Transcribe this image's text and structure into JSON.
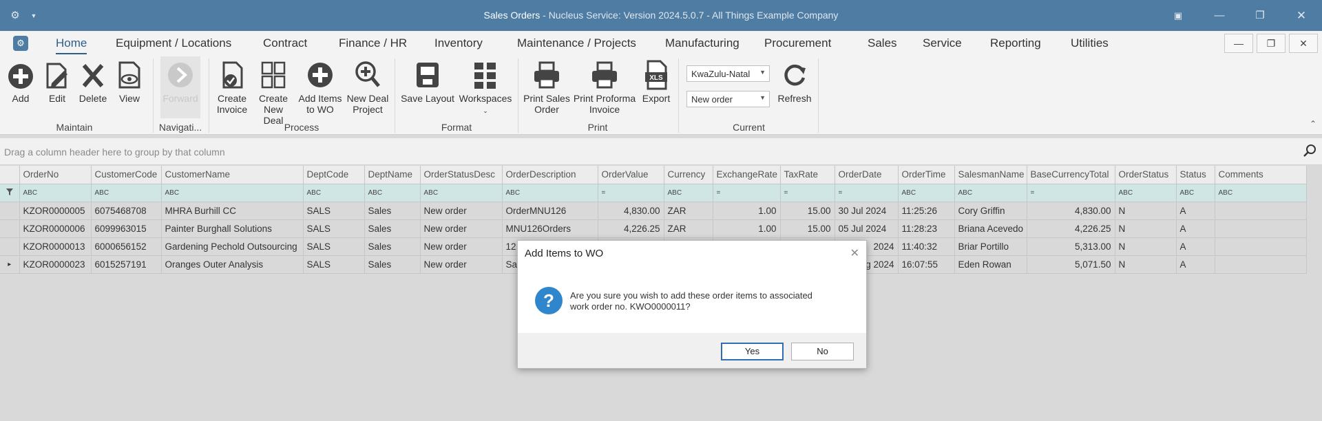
{
  "titlebar": {
    "app_title": "Sales Orders",
    "rest": " - Nucleus Service: Version 2024.5.0.7 - All Things Example Company"
  },
  "menu": {
    "items": [
      "Home",
      "Equipment / Locations",
      "Contract",
      "Finance / HR",
      "Inventory",
      "Maintenance / Projects",
      "Manufacturing",
      "Procurement",
      "Sales",
      "Service",
      "Reporting",
      "Utilities"
    ],
    "active": "Home"
  },
  "ribbon": {
    "maintain": {
      "label": "Maintain",
      "add": "Add",
      "edit": "Edit",
      "delete": "Delete",
      "view": "View"
    },
    "navigation": {
      "label": "Navigati...",
      "forward": "Forward"
    },
    "process": {
      "label": "Process",
      "create_invoice": [
        "Create",
        "Invoice"
      ],
      "create_new_deal": [
        "Create",
        "New Deal"
      ],
      "add_items_to_wo": [
        "Add Items",
        "to WO"
      ],
      "new_deal_project": [
        "New Deal",
        "Project"
      ]
    },
    "format": {
      "label": "Format",
      "save_layout": "Save Layout",
      "workspaces": "Workspaces"
    },
    "print": {
      "label": "Print",
      "print_sales_order": [
        "Print Sales",
        "Order"
      ],
      "print_proforma_invoice": [
        "Print Proforma",
        "Invoice"
      ],
      "export": "Export",
      "export_badge": "XLS"
    },
    "current": {
      "label": "Current",
      "region": "KwaZulu-Natal",
      "status": "New order",
      "refresh": "Refresh"
    }
  },
  "grouppanel": {
    "hint": "Drag a column header here to group by that column"
  },
  "grid": {
    "columns": [
      "OrderNo",
      "CustomerCode",
      "CustomerName",
      "DeptCode",
      "DeptName",
      "OrderStatusDesc",
      "OrderDescription",
      "OrderValue",
      "Currency",
      "ExchangeRate",
      "TaxRate",
      "OrderDate",
      "OrderTime",
      "SalesmanName",
      "BaseCurrencyTotal",
      "OrderStatus",
      "Status",
      "Comments"
    ],
    "filter_icons": [
      "ABC",
      "ABC",
      "ABC",
      "ABC",
      "ABC",
      "ABC",
      "ABC",
      "=",
      "ABC",
      "=",
      "=",
      "=",
      "ABC",
      "ABC",
      "=",
      "ABC",
      "ABC",
      "ABC"
    ],
    "rows": [
      [
        "KZOR0000005",
        "6075468708",
        "MHRA Burhill CC",
        "SALS",
        "Sales",
        "New order",
        "OrderMNU126",
        "4,830.00",
        "ZAR",
        "1.00",
        "15.00",
        "30 Jul 2024",
        "11:25:26",
        "Cory Griffin",
        "4,830.00",
        "N",
        "A",
        ""
      ],
      [
        "KZOR0000006",
        "6099963015",
        "Painter Burghall Solutions",
        "SALS",
        "Sales",
        "New order",
        "MNU126Orders",
        "4,226.25",
        "ZAR",
        "1.00",
        "15.00",
        "05 Jul 2024",
        "11:28:23",
        "Briana Acevedo",
        "4,226.25",
        "N",
        "A",
        ""
      ],
      [
        "KZOR0000013",
        "6000656152",
        "Gardening Pechold Outsourcing",
        "SALS",
        "Sales",
        "New order",
        "12",
        "",
        "",
        "",
        "",
        "2024",
        "11:40:32",
        "Briar Portillo",
        "5,313.00",
        "N",
        "A",
        ""
      ],
      [
        "KZOR0000023",
        "6015257191",
        "Oranges Outer Analysis",
        "SALS",
        "Sales",
        "New order",
        "Sa",
        "",
        "",
        "",
        "",
        "g 2024",
        "16:07:55",
        "Eden Rowan",
        "5,071.50",
        "N",
        "A",
        ""
      ]
    ]
  },
  "dialog": {
    "title": "Add Items to WO",
    "message_line1": "Are you sure you wish to add these order items to associated",
    "message_line2": "work order no. KWO0000011?",
    "yes": "Yes",
    "no": "No"
  }
}
